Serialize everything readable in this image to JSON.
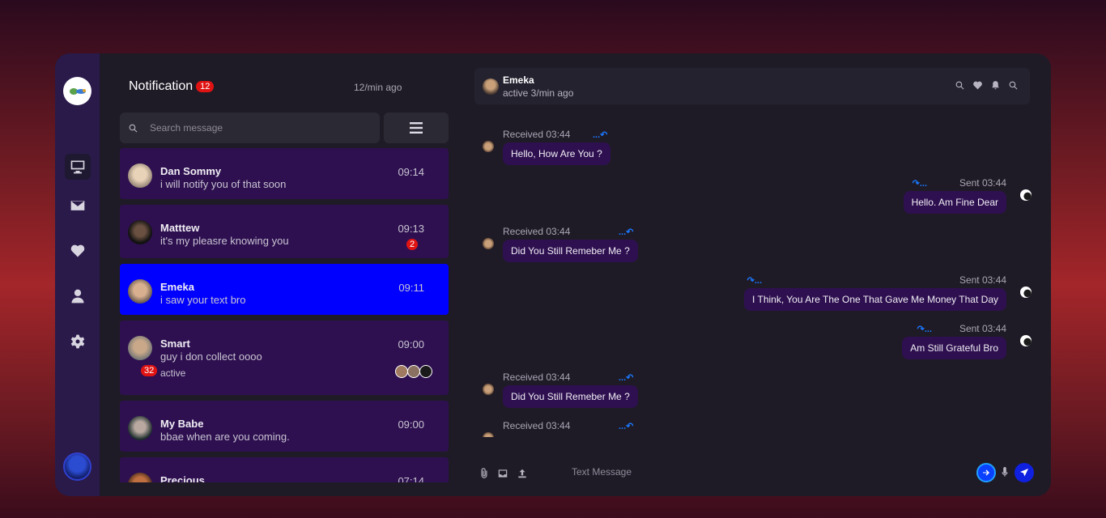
{
  "notification": {
    "title": "Notification",
    "badge": "12",
    "time": "12/min ago"
  },
  "search": {
    "placeholder": "Search message"
  },
  "conversations": [
    {
      "name": "Dan Sommy",
      "message": "i will notify you of that soon",
      "time": "09:14"
    },
    {
      "name": "Matttew",
      "message": "it's my pleasre knowing you",
      "time": "09:13",
      "count": "2"
    },
    {
      "name": "Emeka",
      "message": "i saw your text bro",
      "time": "09:11"
    },
    {
      "name": "Smart",
      "message": "guy i don collect oooo",
      "time": "09:00",
      "count": "32",
      "status": "active"
    },
    {
      "name": "My Babe",
      "message": "bbae when are you coming.",
      "time": "09:00"
    },
    {
      "name": "Precious",
      "message": "",
      "time": "07:14"
    }
  ],
  "chat": {
    "contact_name": "Emeka",
    "contact_status": "active 3/min ago",
    "reply_marker": "...",
    "messages": [
      {
        "direction": "received",
        "meta": "Received 03:44",
        "text": "Hello, How Are You ?"
      },
      {
        "direction": "sent",
        "meta": "Sent 03:44",
        "text": "Hello. Am Fine Dear"
      },
      {
        "direction": "received",
        "meta": "Received 03:44",
        "text": "Did You Still Remeber Me ?"
      },
      {
        "direction": "sent",
        "meta": "Sent 03:44",
        "text": "I Think, You Are The One That Gave Me Money That Day"
      },
      {
        "direction": "sent",
        "meta": "Sent 03:44",
        "text": "Am Still Grateful Bro"
      },
      {
        "direction": "received",
        "meta": "Received 03:44",
        "text": "Did You Still Remeber Me ?"
      },
      {
        "direction": "received",
        "meta": "Received 03:44",
        "text": ""
      }
    ]
  },
  "compose": {
    "placeholder": "Text Message"
  },
  "colors": {
    "accent": "#0000ff",
    "bubble": "#2e1050",
    "badge": "#e01313",
    "reply_arrow": "#1a78ff"
  }
}
